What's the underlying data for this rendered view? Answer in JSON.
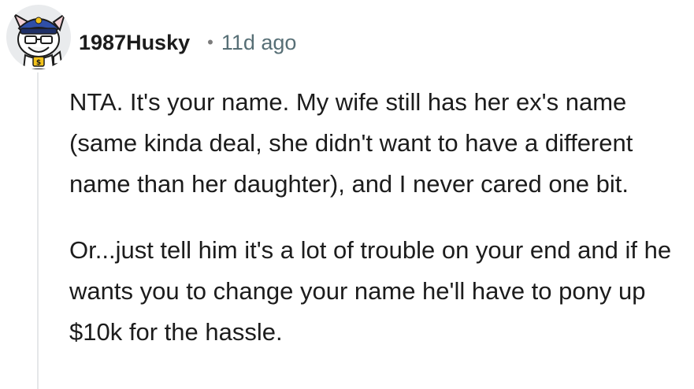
{
  "comment": {
    "author": "1987Husky",
    "separator": "•",
    "age": "11d ago",
    "avatar_icon": "snoo-avatar-icon",
    "paragraphs": [
      "NTA. It's your name. My wife still has her ex's name (same kinda deal, she didn't want to have a different name than her daughter), and I never cared one bit.",
      "Or...just tell him it's a lot of trouble on your end and if he wants you to change your name he'll have to pony up $10k for the hassle."
    ]
  },
  "colors": {
    "text": "#1c1c1c",
    "meta": "#576f76",
    "thread_line": "#e5e7e9",
    "avatar_bg": "#e9ebed",
    "hat": "#2f4fa8",
    "badge": "#f2c21b"
  }
}
